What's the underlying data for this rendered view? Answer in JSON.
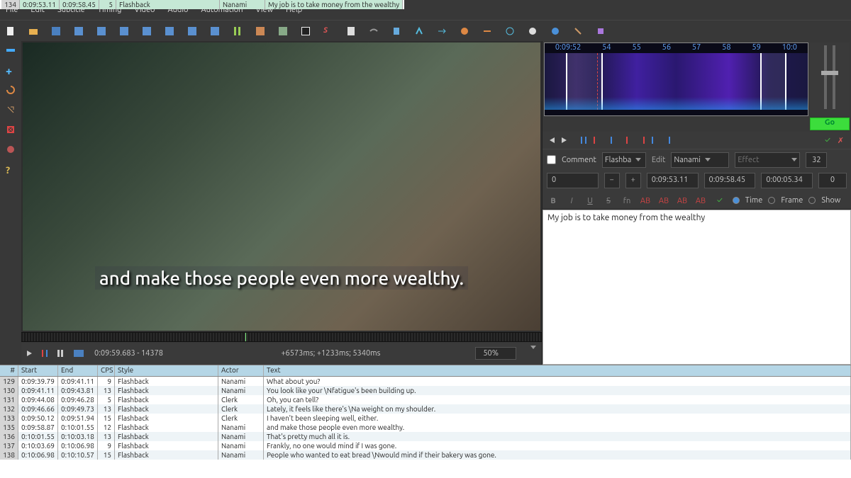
{
  "menu": [
    "File",
    "Edit",
    "Subtitle",
    "Timing",
    "Video",
    "Audio",
    "Automation",
    "View",
    "Help"
  ],
  "subtitle_overlay": "and make those people even more wealthy.",
  "video_bar": {
    "position": "0:09:59.683 - 14378",
    "timing": "+6573ms; +1233ms; 5340ms",
    "zoom": "50%"
  },
  "waveform_ticks": [
    "0:09:52",
    "54",
    "55",
    "56",
    "57",
    "58",
    "59",
    "10:0"
  ],
  "go_button": "Go",
  "edit": {
    "comment_label": "Comment",
    "style": "Flashba",
    "edit_label": "Edit",
    "actor": "Nanami",
    "effect_label": "Effect",
    "margin": "32",
    "layer": "0",
    "start": "0:09:53.11",
    "end": "0:09:58.45",
    "duration": "0:00:05.34",
    "margin_r": "0",
    "mode_time": "Time",
    "mode_frame": "Frame",
    "mode_show": "Show",
    "text": "My job is to take money from the wealthy"
  },
  "columns": {
    "n": "#",
    "start": "Start",
    "end": "End",
    "cps": "CPS",
    "style": "Style",
    "actor": "Actor",
    "text": "Text"
  },
  "rows": [
    {
      "n": "129",
      "s": "0:09:39.79",
      "e": "0:09:41.11",
      "c": "9",
      "st": "Flashback",
      "a": "Nanami",
      "t": "What about you?"
    },
    {
      "n": "130",
      "s": "0:09:41.11",
      "e": "0:09:43.81",
      "c": "13",
      "st": "Flashback",
      "a": "Nanami",
      "t": "You look like your \\Nfatigue's been building up."
    },
    {
      "n": "131",
      "s": "0:09:44.08",
      "e": "0:09:46.28",
      "c": "5",
      "st": "Flashback",
      "a": "Clerk",
      "t": "Oh, you can tell?"
    },
    {
      "n": "132",
      "s": "0:09:46.66",
      "e": "0:09:49.73",
      "c": "13",
      "st": "Flashback",
      "a": "Clerk",
      "t": "Lately, it feels like there's \\Na weight on my shoulder."
    },
    {
      "n": "133",
      "s": "0:09:50.12",
      "e": "0:09:51.94",
      "c": "15",
      "st": "Flashback",
      "a": "Clerk",
      "t": "I haven't been sleeping well, either."
    },
    {
      "n": "134",
      "s": "0:09:53.11",
      "e": "0:09:58.45",
      "c": "5",
      "st": "Flashback",
      "a": "Nanami",
      "t": "My job is to take money from the wealthy",
      "sel": true
    },
    {
      "n": "135",
      "s": "0:09:58.87",
      "e": "0:10:01.55",
      "c": "12",
      "st": "Flashback",
      "a": "Nanami",
      "t": "and make those people even more wealthy."
    },
    {
      "n": "136",
      "s": "0:10:01.55",
      "e": "0:10:03.18",
      "c": "13",
      "st": "Flashback",
      "a": "Nanami",
      "t": "That's pretty much all it is."
    },
    {
      "n": "137",
      "s": "0:10:03.69",
      "e": "0:10:06.98",
      "c": "9",
      "st": "Flashback",
      "a": "Nanami",
      "t": "Frankly, no one would mind if I was gone."
    },
    {
      "n": "138",
      "s": "0:10:06.98",
      "e": "0:10:10.57",
      "c": "15",
      "st": "Flashback",
      "a": "Nanami",
      "t": "People who wanted to eat bread \\Nwould mind if their bakery was gone."
    }
  ]
}
